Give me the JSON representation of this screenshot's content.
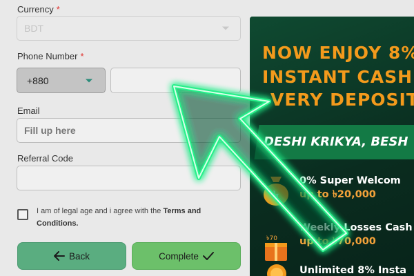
{
  "form": {
    "currency": {
      "label": "Currency",
      "required_mark": "*",
      "value": "BDT"
    },
    "phone": {
      "label": "Phone Number",
      "required_mark": "*",
      "code": "+880",
      "number": ""
    },
    "email": {
      "label": "Email",
      "placeholder": "Fill up here"
    },
    "referral": {
      "label": "Referral Code",
      "value": ""
    },
    "terms": {
      "text": "I am of legal age and i agree with the",
      "link": "Terms and Conditions."
    },
    "buttons": {
      "back": "Back",
      "complete": "Complete"
    }
  },
  "banner": {
    "line1": "NOW ENJOY 8%",
    "line2": "INSTANT CASH",
    "line3": "VERY DEPOSIT",
    "strip": "DESHI KRIKYA, BESH",
    "promos": [
      {
        "title": "0% Super Welcom",
        "sub": "up to ৳20,000"
      },
      {
        "title": "Weekly Losses Cash",
        "sub": "up to ৳70,000"
      },
      {
        "title": "Unlimited 8% Insta",
        "sub": ""
      }
    ],
    "box_badge": "৳70"
  },
  "colors": {
    "accent_green": "#6cc06a",
    "back_green": "#5aad80",
    "banner_orange": "#f39a1c",
    "arrow_glow": "#27f08a"
  }
}
